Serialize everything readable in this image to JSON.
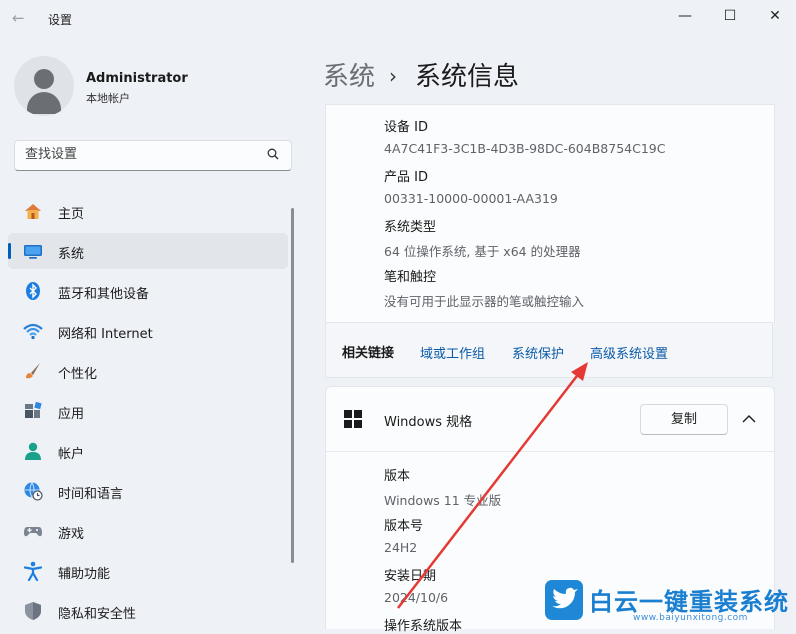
{
  "app": {
    "title": "设置",
    "back_symbol": "←",
    "minimize_symbol": "—",
    "maximize_symbol": "☐",
    "close_symbol": "✕"
  },
  "user": {
    "name": "Administrator",
    "account_type": "本地帐户"
  },
  "search": {
    "placeholder": "查找设置",
    "icon": "search-icon"
  },
  "sidebar": {
    "selected": "系统",
    "items": [
      {
        "label": "主页",
        "icon": "home-icon"
      },
      {
        "label": "系统",
        "icon": "monitor-icon"
      },
      {
        "label": "蓝牙和其他设备",
        "icon": "bluetooth-icon"
      },
      {
        "label": "网络和 Internet",
        "icon": "wifi-icon"
      },
      {
        "label": "个性化",
        "icon": "brush-icon"
      },
      {
        "label": "应用",
        "icon": "apps-icon"
      },
      {
        "label": "帐户",
        "icon": "account-icon"
      },
      {
        "label": "时间和语言",
        "icon": "globe-clock-icon"
      },
      {
        "label": "游戏",
        "icon": "gamepad-icon"
      },
      {
        "label": "辅助功能",
        "icon": "accessibility-icon"
      },
      {
        "label": "隐私和安全性",
        "icon": "shield-icon"
      }
    ]
  },
  "breadcrumb": {
    "parent": "系统",
    "separator": "›",
    "current": "系统信息"
  },
  "device_specs": {
    "rows": [
      {
        "label": "设备 ID",
        "value": "4A7C41F3-3C1B-4D3B-98DC-604B8754C19C"
      },
      {
        "label": "产品 ID",
        "value": "00331-10000-00001-AA319"
      },
      {
        "label": "系统类型",
        "value": "64 位操作系统, 基于 x64 的处理器"
      },
      {
        "label": "笔和触控",
        "value": "没有可用于此显示器的笔或触控输入"
      }
    ]
  },
  "related_links": {
    "title": "相关链接",
    "links": [
      "域或工作组",
      "系统保护",
      "高级系统设置"
    ]
  },
  "windows_specs": {
    "title": "Windows 规格",
    "copy_label": "复制",
    "rows": [
      {
        "label": "版本",
        "value": "Windows 11 专业版"
      },
      {
        "label": "版本号",
        "value": "24H2"
      },
      {
        "label": "安装日期",
        "value": "2024/10/6"
      },
      {
        "label": "操作系统版本",
        "value": ""
      }
    ]
  },
  "watermark": {
    "text": "白云一键重装系统",
    "url": "www.baiyunxitong.com"
  },
  "colors": {
    "accent": "#005fb8",
    "link": "#0a5aa8",
    "annotation_arrow": "#e53935"
  }
}
